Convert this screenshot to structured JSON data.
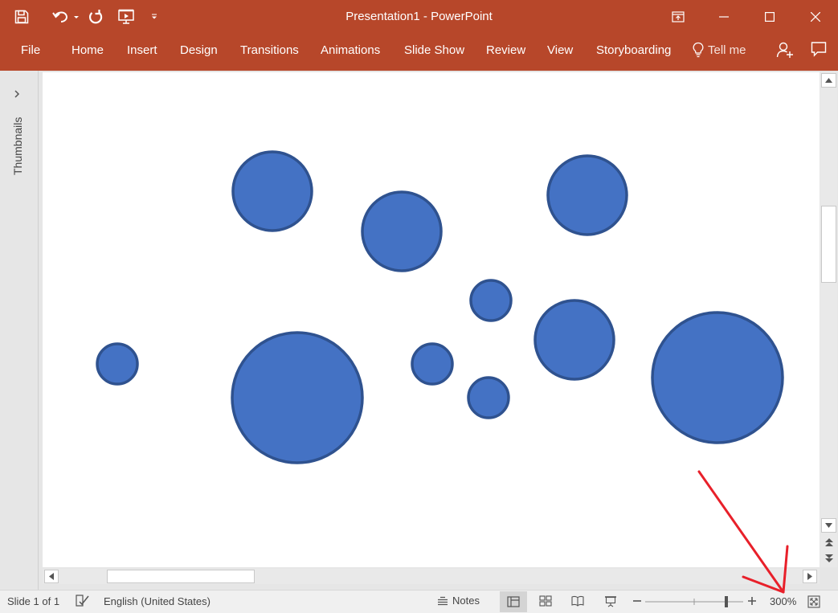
{
  "app": {
    "title": "Presentation1  -  PowerPoint"
  },
  "colors": {
    "accent": "#b7472a",
    "shape_fill": "#4472c4",
    "shape_stroke": "#2f528f",
    "arrow": "#e8202a"
  },
  "quick_access": [
    {
      "name": "save-icon"
    },
    {
      "name": "undo-icon"
    },
    {
      "name": "redo-icon"
    },
    {
      "name": "start-from-beginning-icon"
    },
    {
      "name": "customize-qat-icon"
    }
  ],
  "window_controls": [
    {
      "name": "ribbon-display-options-icon"
    },
    {
      "name": "minimize-icon"
    },
    {
      "name": "maximize-icon"
    },
    {
      "name": "close-icon"
    }
  ],
  "ribbon": {
    "tabs": [
      {
        "label": "File"
      },
      {
        "label": "Home"
      },
      {
        "label": "Insert"
      },
      {
        "label": "Design"
      },
      {
        "label": "Transitions"
      },
      {
        "label": "Animations"
      },
      {
        "label": "Slide Show"
      },
      {
        "label": "Review"
      },
      {
        "label": "View"
      },
      {
        "label": "Storyboarding"
      }
    ],
    "tell_me": "Tell me"
  },
  "thumbnails_pane": {
    "label": "Thumbnails"
  },
  "slide": {
    "shapes": [
      {
        "type": "circle"
      },
      {
        "type": "circle"
      },
      {
        "type": "circle"
      },
      {
        "type": "circle"
      },
      {
        "type": "circle"
      },
      {
        "type": "circle"
      },
      {
        "type": "circle"
      },
      {
        "type": "circle"
      },
      {
        "type": "circle"
      },
      {
        "type": "circle"
      }
    ]
  },
  "status_bar": {
    "slide_info": "Slide 1 of 1",
    "language": "English (United States)",
    "notes_label": "Notes",
    "zoom_level": "300%"
  }
}
